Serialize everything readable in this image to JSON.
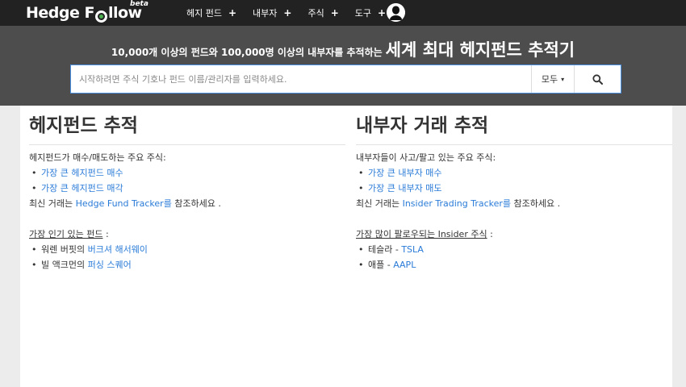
{
  "header": {
    "logo_text_1": "Hedge F",
    "logo_text_2": "llow",
    "logo_beta": "beta",
    "nav": [
      {
        "label": "헤지 펀드",
        "plus": "+"
      },
      {
        "label": "내부자",
        "plus": "+"
      },
      {
        "label": "주식",
        "plus": "+"
      },
      {
        "label": "도구",
        "plus": "+"
      }
    ]
  },
  "hero": {
    "tagline_small": "10,000개 이상의 펀드와 100,000명 이상의 내부자를 추적하는",
    "tagline_big": "세계 최대 헤지펀드 추적기",
    "search_placeholder": "시작하려면 주식 기호나 펀드 이름/관리자를 입력하세요.",
    "filter_label": "모두",
    "filter_caret": "▾"
  },
  "left": {
    "title": "헤지펀드 추적",
    "intro": "헤지펀드가 매수/매도하는 주요 주식:",
    "links": [
      "가장 큰 헤지펀드 매수",
      "가장 큰 헤지펀드 매각"
    ],
    "recent_prefix": "최신 거래는 ",
    "recent_link": "Hedge Fund Tracker를",
    "recent_suffix": " 참조하세요 .",
    "popular_heading": "가장 인기 있는 펀드",
    "popular_colon": " :",
    "funds": [
      {
        "prefix": "워렌 버핏의 ",
        "link": "버크셔 해서웨이"
      },
      {
        "prefix": "빌 액크먼의 ",
        "link": "퍼싱 스퀘어"
      }
    ]
  },
  "right": {
    "title": "내부자 거래 추적",
    "intro": "내부자들이 사고/팔고 있는 주요 주식:",
    "links": [
      "가장 큰 내부자 매수",
      "가장 큰 내부자 매도"
    ],
    "recent_prefix": "최신 거래는 ",
    "recent_link": "Insider Trading Tracker를",
    "recent_suffix": " 참조하세요 .",
    "popular_heading": "가장 많이 팔로우되는 Insider 주식",
    "popular_colon": " :",
    "stocks": [
      {
        "prefix": "테슬라 - ",
        "link": "TSLA"
      },
      {
        "prefix": "애플 - ",
        "link": "AAPL"
      }
    ]
  },
  "colors": {
    "nav_bg": "#222222",
    "hero_bg": "#4d4d4d",
    "link": "#2a7bd8",
    "logo_accent": "#4caf50"
  },
  "icons": {
    "search": "search-icon",
    "user": "user-avatar-icon"
  }
}
